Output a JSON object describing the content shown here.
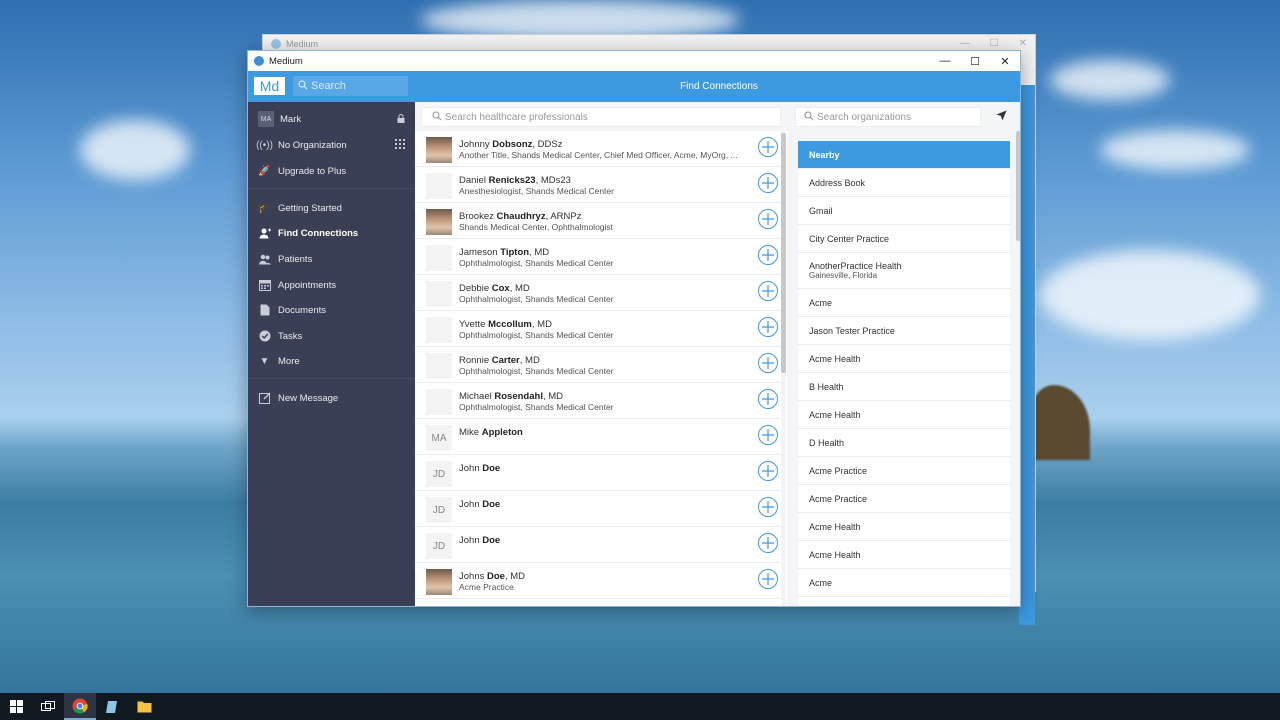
{
  "background_window": {
    "title": "Medium"
  },
  "window": {
    "title": "Medium",
    "minimize": "—",
    "maximize": "☐",
    "close": "✕"
  },
  "header": {
    "brand": "Md",
    "search_placeholder": "Search",
    "page_title": "Find Connections"
  },
  "sidebar": {
    "user": {
      "initials": "MA",
      "name": "Mark",
      "icon": "lock-icon"
    },
    "items": [
      {
        "label": "No Organization",
        "icon": "broadcast-icon"
      },
      {
        "label": "Upgrade to Plus",
        "icon": "rocket-icon"
      },
      {
        "label": "Getting Started",
        "icon": "graduation-cap-icon"
      },
      {
        "label": "Find Connections",
        "icon": "add-user-icon",
        "active": true
      },
      {
        "label": "Patients",
        "icon": "users-icon"
      },
      {
        "label": "Appointments",
        "icon": "calendar-icon"
      },
      {
        "label": "Documents",
        "icon": "document-icon"
      },
      {
        "label": "Tasks",
        "icon": "check-circle-icon"
      },
      {
        "label": "More",
        "icon": "caret-down-icon"
      },
      {
        "label": "New Message",
        "icon": "compose-icon"
      }
    ]
  },
  "search": {
    "professionals_placeholder": "Search healthcare professionals",
    "organizations_placeholder": "Search organizations"
  },
  "professionals": [
    {
      "first": "Johnny",
      "last": "Dobsonz",
      "suffix": ", DDSz",
      "sub": "Another Title, Shands Medical Center, Chief Med Officer, Acme, MyOrg, ...",
      "photo": "photo",
      "initials": ""
    },
    {
      "first": "Daniel",
      "last": "Renicks23",
      "suffix": ", MDs23",
      "sub": "Anesthesiologist, Shands Medical Center",
      "photo": "blank",
      "initials": ""
    },
    {
      "first": "Brookez",
      "last": "Chaudhryz",
      "suffix": ", ARNPz",
      "sub": "Shands Medical Center, Ophthalmologist",
      "photo": "photo",
      "initials": ""
    },
    {
      "first": "Jameson",
      "last": "Tipton",
      "suffix": ", MD",
      "sub": "Ophthalmologist, Shands Medical Center",
      "photo": "blank",
      "initials": ""
    },
    {
      "first": "Debbie",
      "last": "Cox",
      "suffix": ", MD",
      "sub": "Ophthalmologist, Shands Medical Center",
      "photo": "blank",
      "initials": ""
    },
    {
      "first": "Yvette",
      "last": "Mccollum",
      "suffix": ", MD",
      "sub": "Ophthalmologist, Shands Medical Center",
      "photo": "blank",
      "initials": ""
    },
    {
      "first": "Ronnie",
      "last": "Carter",
      "suffix": ", MD",
      "sub": "Ophthalmologist, Shands Medical Center",
      "photo": "blank",
      "initials": ""
    },
    {
      "first": "Michael",
      "last": "Rosendahl",
      "suffix": ", MD",
      "sub": "Ophthalmologist, Shands Medical Center",
      "photo": "blank",
      "initials": ""
    },
    {
      "first": "Mike",
      "last": "Appleton",
      "suffix": "",
      "sub": "",
      "photo": "initials",
      "initials": "MA"
    },
    {
      "first": "John",
      "last": "Doe",
      "suffix": "",
      "sub": "",
      "photo": "initials",
      "initials": "JD"
    },
    {
      "first": "John",
      "last": "Doe",
      "suffix": "",
      "sub": "",
      "photo": "initials",
      "initials": "JD"
    },
    {
      "first": "John",
      "last": "Doe",
      "suffix": "",
      "sub": "",
      "photo": "initials",
      "initials": "JD"
    },
    {
      "first": "Johns",
      "last": "Doe",
      "suffix": ", MD",
      "sub": "Acme Practice",
      "photo": "photo",
      "initials": ""
    }
  ],
  "organizations": [
    {
      "name": "Nearby",
      "active": true,
      "location": ""
    },
    {
      "name": "Address Book",
      "location": ""
    },
    {
      "name": "Gmail",
      "location": ""
    },
    {
      "name": "City Center Practice",
      "location": ""
    },
    {
      "name": "AnotherPractice Health",
      "location": "Gainesville, Florida"
    },
    {
      "name": "Acme",
      "location": ""
    },
    {
      "name": "Jason Tester Practice",
      "location": ""
    },
    {
      "name": "Acme Health",
      "location": ""
    },
    {
      "name": "B Health",
      "location": ""
    },
    {
      "name": "Acme Health",
      "location": ""
    },
    {
      "name": "D Health",
      "location": ""
    },
    {
      "name": "Acme Practice",
      "location": ""
    },
    {
      "name": "Acme Practice",
      "location": ""
    },
    {
      "name": "Acme Health",
      "location": ""
    },
    {
      "name": "Acme Health",
      "location": ""
    },
    {
      "name": "Acme",
      "location": ""
    },
    {
      "name": "Acme",
      "location": ""
    }
  ],
  "taskbar": {
    "items": [
      "windows-start-icon",
      "task-view-icon",
      "chrome-icon",
      "notepad-icon",
      "file-explorer-icon"
    ]
  },
  "colors": {
    "accent": "#3d99e0",
    "sidebar": "#3a3f55"
  }
}
